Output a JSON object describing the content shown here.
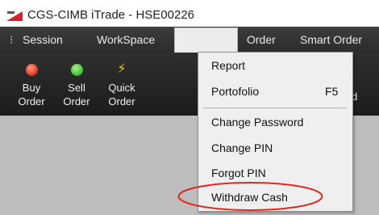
{
  "window": {
    "title": "CGS-CIMB iTrade - HSE00226",
    "logo_icon": "cgs-cimb-logo"
  },
  "menubar": {
    "grip": "⁝",
    "items": [
      "Session",
      "WorkSpace",
      "",
      "Order",
      "Smart Order"
    ]
  },
  "toolbar": {
    "buttons": [
      {
        "line1": "Buy",
        "line2": "Order",
        "icon": "red-circle-icon"
      },
      {
        "line1": "Sell",
        "line2": "Order",
        "icon": "green-circle-icon"
      },
      {
        "line1": "Quick",
        "line2": "Order",
        "icon": "lightning-icon"
      }
    ],
    "partial_label": "d"
  },
  "dropdown": {
    "items": [
      {
        "label": "Report",
        "shortcut": ""
      },
      {
        "label": "Portofolio",
        "shortcut": "F5"
      },
      {
        "label": "Change Password",
        "shortcut": ""
      },
      {
        "label": "Change PIN",
        "shortcut": ""
      },
      {
        "label": "Forgot PIN",
        "shortcut": ""
      },
      {
        "label": "Withdraw Cash",
        "shortcut": ""
      }
    ],
    "highlighted_item": "Withdraw Cash"
  },
  "colors": {
    "highlight_ring": "#e0281f",
    "menubar": "#333333",
    "toolbar": "#242424",
    "workspace": "#bdbdbd"
  }
}
